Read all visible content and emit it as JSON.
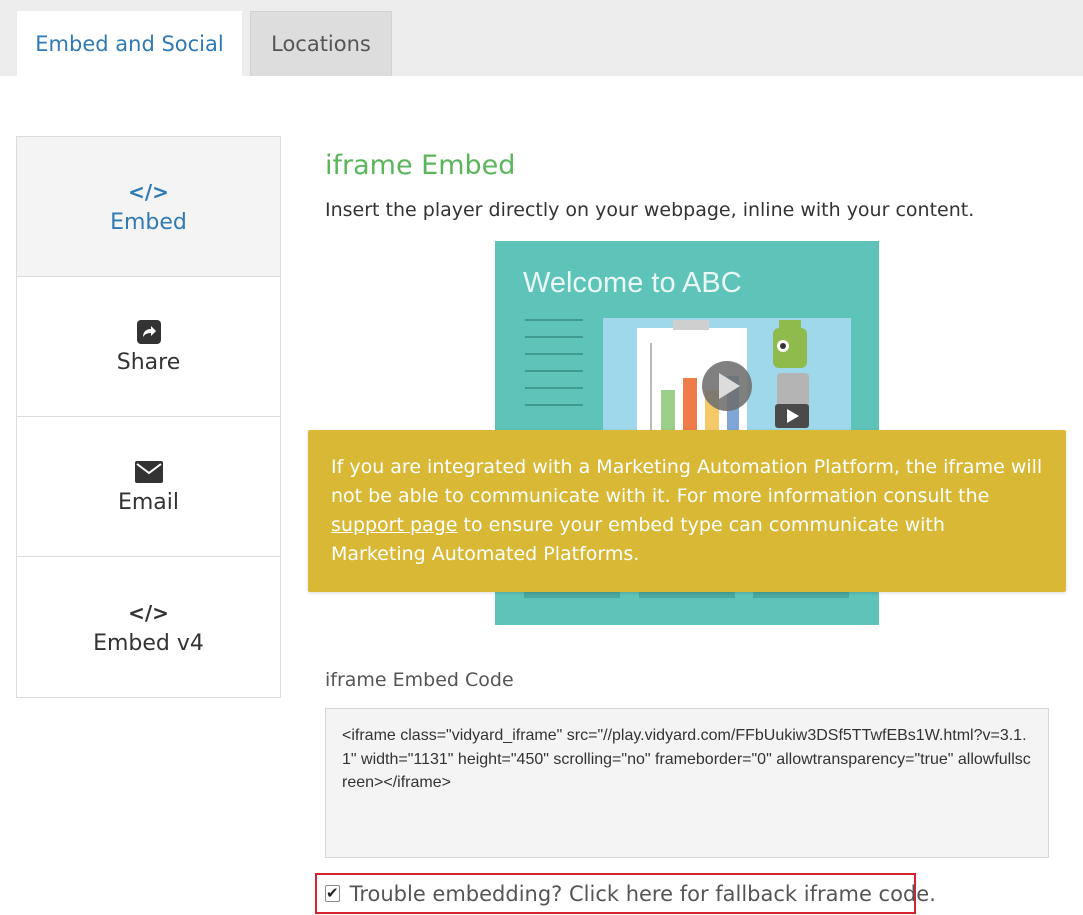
{
  "tabs": [
    {
      "label": "Embed and Social",
      "active": true
    },
    {
      "label": "Locations",
      "active": false
    }
  ],
  "sidenav": {
    "items": [
      {
        "icon": "code-icon",
        "glyph": "</>",
        "label": "Embed",
        "active": true
      },
      {
        "icon": "share-icon",
        "label": "Share",
        "active": false
      },
      {
        "icon": "envelope-icon",
        "label": "Email",
        "active": false
      },
      {
        "icon": "code-icon",
        "glyph": "</>",
        "label": "Embed v4",
        "active": false
      }
    ]
  },
  "main": {
    "title": "iframe Embed",
    "description": "Insert the player directly on your webpage, inline with your content.",
    "preview": {
      "title": "Welcome to ABC"
    },
    "notice": {
      "text_before": "If you are integrated with a Marketing Automation Platform, the iframe will not be able to communicate with it. For more information consult the ",
      "link_text": "support page",
      "text_after": " to ensure your embed type can communicate with Marketing Automated Platforms."
    },
    "code_label": "iframe Embed Code",
    "code_value": "<iframe class=\"vidyard_iframe\" src=\"//play.vidyard.com/FFbUukiw3DSf5TTwfEBs1W.html?v=3.1.1\" width=\"1131\" height=\"450\" scrolling=\"no\" frameborder=\"0\" allowtransparency=\"true\" allowfullscreen></iframe>",
    "fallback": {
      "checked": true,
      "label": "Trouble embedding? Click here for fallback iframe code."
    }
  },
  "colors": {
    "accent_blue": "#2f7ab5",
    "heading_green": "#5bb55b",
    "notice_yellow": "#d9b836",
    "preview_teal": "#5ec3b8",
    "highlight_red": "#d6232d"
  }
}
